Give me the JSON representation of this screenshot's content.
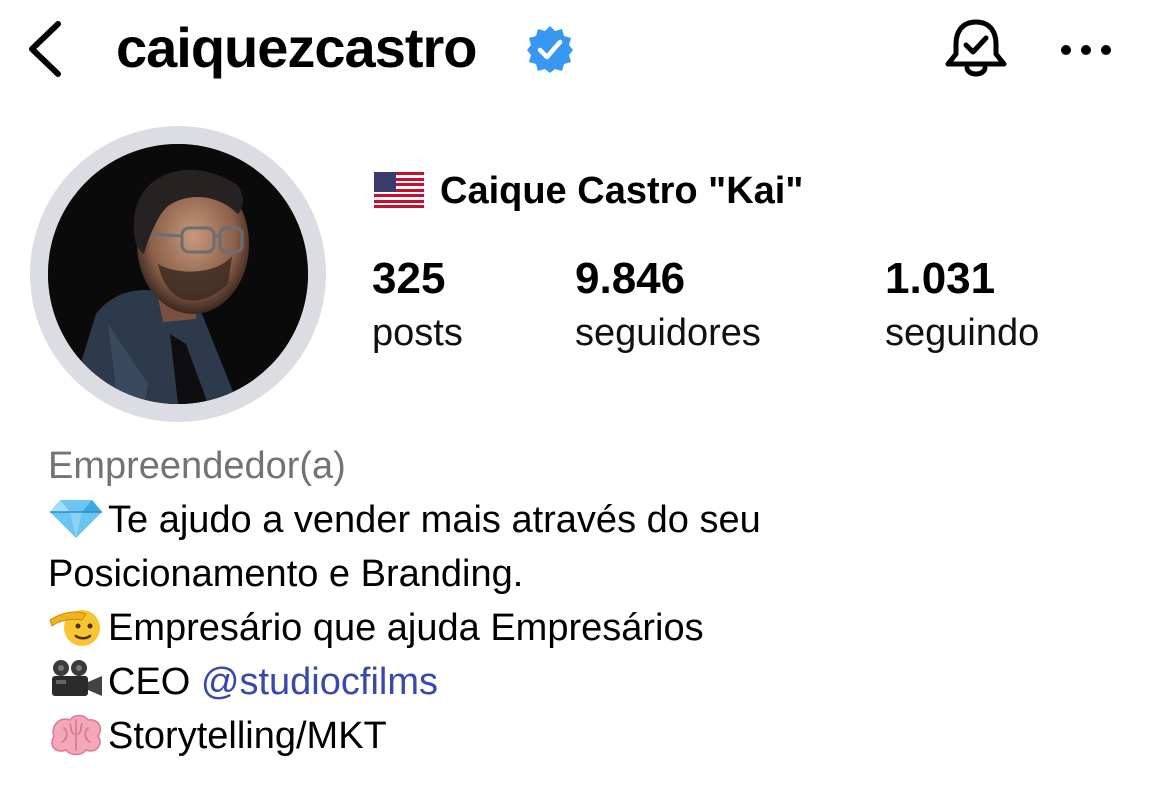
{
  "header": {
    "username": "caiquezcastro",
    "icons": {
      "back": "chevron-left-icon",
      "verified": "verified-badge-icon",
      "notifications": "bell-check-icon",
      "more": "more-horizontal-icon"
    }
  },
  "profile": {
    "flag": "🇺🇸",
    "display_name": "Caique Castro \"Kai\"",
    "stats": {
      "posts": {
        "value": "325",
        "label": "posts"
      },
      "followers": {
        "value": "9.846",
        "label": "seguidores"
      },
      "following": {
        "value": "1.031",
        "label": "seguindo"
      }
    }
  },
  "bio": {
    "category": "Empreendedor(a)",
    "lines": [
      {
        "emoji": "💎",
        "text": "Te ajudo a vender mais através do seu"
      },
      {
        "emoji": "",
        "text": "Posicionamento e Branding."
      },
      {
        "emoji": "🫡",
        "text": "Empresário que ajuda Empresários"
      },
      {
        "emoji": "🎥",
        "text": "CEO ",
        "link": "@studiocfilms"
      },
      {
        "emoji": "🧠",
        "text": "Storytelling/MKT"
      }
    ]
  },
  "colors": {
    "verified_blue": "#3897f0",
    "link": "#3949ab",
    "category_gray": "#737373",
    "avatar_ring": "#dbdde2"
  }
}
